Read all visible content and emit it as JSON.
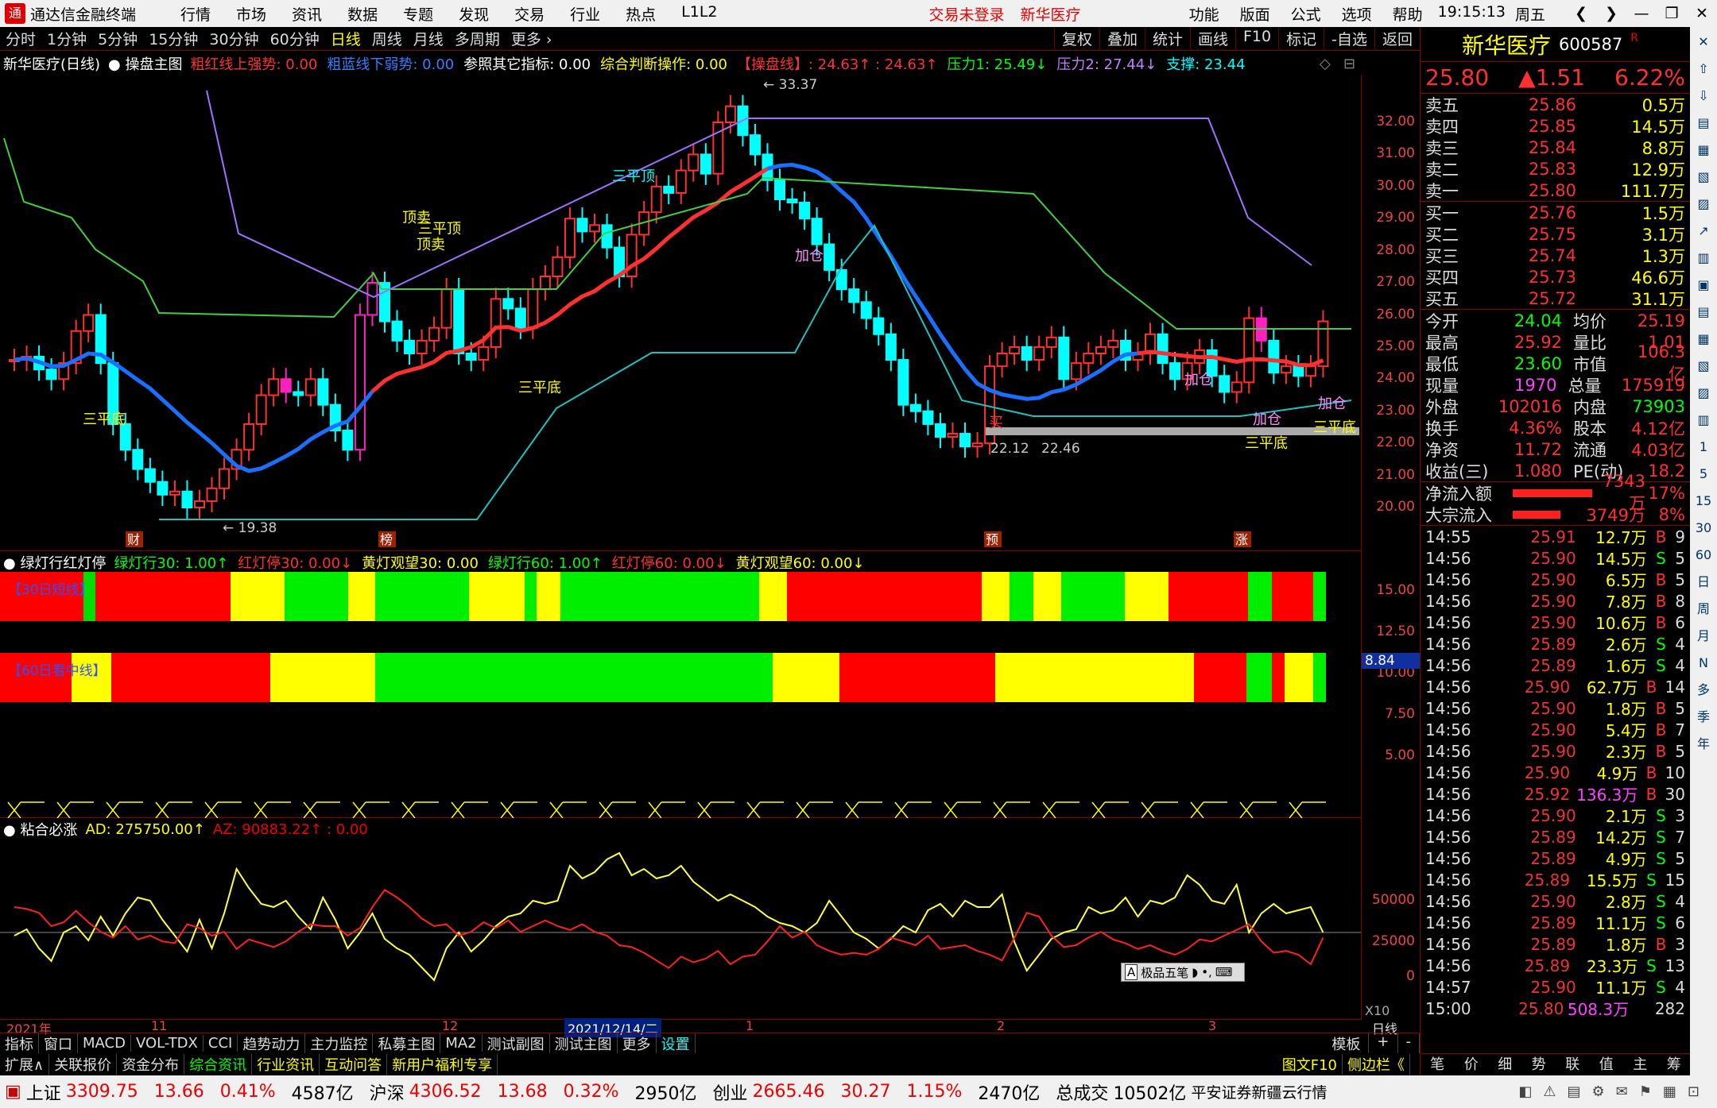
{
  "title_bar": {
    "app_name": "通达信金融终端",
    "menu": [
      "行情",
      "市场",
      "资讯",
      "数据",
      "专题",
      "发现",
      "交易",
      "行业",
      "热点",
      "L1L2"
    ],
    "login_status": "交易未登录",
    "stock_tag": "新华医疗",
    "right_menu": [
      "功能",
      "版面",
      "公式",
      "选项",
      "帮助"
    ],
    "time": "19:15:13",
    "weekday": "周五"
  },
  "toolbar": {
    "periods": [
      "分时",
      "1分钟",
      "5分钟",
      "15分钟",
      "30分钟",
      "60分钟",
      "日线",
      "周线",
      "月线",
      "多周期",
      "更多"
    ],
    "active": "日线",
    "right_buttons": [
      "复权",
      "叠加",
      "统计",
      "画线",
      "F10",
      "标记",
      "-自选",
      "返回"
    ]
  },
  "main_chart": {
    "header": "新华医疗(日线)",
    "indicator": "操盘主图",
    "items": [
      {
        "label": "粗红线上强势:",
        "value": "0.00",
        "color": "#ff3030"
      },
      {
        "label": "粗蓝线下弱势:",
        "value": "0.00",
        "color": "#3080ff"
      },
      {
        "label": "参照其它指标:",
        "value": "0.00",
        "color": "#ffffff"
      },
      {
        "label": "综合判断操作:",
        "value": "0.00",
        "color": "#ffff00"
      },
      {
        "label": "【操盘线】:",
        "value": "24.63↑ : 24.63↑",
        "color": "#ff3030"
      },
      {
        "label": "压力1:",
        "value": "25.49↓",
        "color": "#00ff00"
      },
      {
        "label": "压力2:",
        "value": "27.44↓",
        "color": "#c080ff"
      },
      {
        "label": "支撑:",
        "value": "23.44",
        "color": "#00ffff"
      }
    ],
    "yticks": [
      "32.00",
      "31.00",
      "30.00",
      "29.00",
      "28.00",
      "27.00",
      "26.00",
      "25.00",
      "24.00",
      "23.00",
      "22.00",
      "21.00",
      "20.00"
    ],
    "annotations": {
      "high": "33.37",
      "low": "19.38",
      "low2a": "22.12",
      "low2b": "22.46",
      "signals": [
        "三平底",
        "三平底",
        "三平底",
        "三平底",
        "顶卖",
        "三平顶",
        "顶卖",
        "三平顶",
        "加仓",
        "加仓",
        "加仓",
        "加仓",
        "买"
      ]
    },
    "markers": [
      "财",
      "榜",
      "预",
      "涨"
    ]
  },
  "light_panel": {
    "header": "绿灯行红灯停",
    "items": [
      {
        "label": "绿灯行30:",
        "value": "1.00↑",
        "color": "#00ff00"
      },
      {
        "label": "红灯停30:",
        "value": "0.00↓",
        "color": "#ff3030"
      },
      {
        "label": "黄灯观望30:",
        "value": "0.00",
        "color": "#ffff00"
      },
      {
        "label": "绿灯行60:",
        "value": "1.00↑",
        "color": "#00ff00"
      },
      {
        "label": "红灯停60:",
        "value": "0.00↓",
        "color": "#ff3030"
      },
      {
        "label": "黄灯观望60:",
        "value": "0.00↓",
        "color": "#ffff00"
      }
    ],
    "band1_label": "【30日短线】",
    "band2_label": "【60日看中线】",
    "yticks": [
      "15.00",
      "12.50",
      "10.00",
      "7.50",
      "5.00"
    ],
    "current": "8.84"
  },
  "ad_panel": {
    "header": "粘合必涨",
    "ad": "AD: 275750.00↑",
    "az": "AZ: 90883.22↑ : 0.00",
    "yticks": [
      "50000",
      "25000",
      "0"
    ],
    "x_label": "X10",
    "ime": "极品五笔"
  },
  "x_axis": {
    "labels": [
      "2021年",
      "11",
      "12",
      "2021/12/14/二",
      "1",
      "2",
      "3"
    ],
    "period": "日线"
  },
  "bottom_tabs": [
    "指标",
    "窗口",
    "MACD",
    "VOL-TDX",
    "CCI",
    "趋势动力",
    "主力监控",
    "私募主图",
    "MA2",
    "测试副图",
    "测试主图",
    "更多",
    "设置"
  ],
  "bottom_right": [
    "模板",
    "+",
    "-"
  ],
  "bottom_tabs2": [
    "扩展∧",
    "关联报价",
    "资金分布",
    "综合资讯",
    "行业资讯",
    "互动问答",
    "新用户福利专享"
  ],
  "bottom_right2": [
    "图文F10",
    "侧边栏《"
  ],
  "quote_tabs": [
    "笔",
    "价",
    "细",
    "势",
    "联",
    "值",
    "主",
    "筹"
  ],
  "stock": {
    "name": "新华医疗",
    "code": "600587",
    "flag": "R",
    "price": "25.80",
    "change": "▲1.51",
    "pct": "6.22%"
  },
  "asks": [
    {
      "l": "卖五",
      "p": "25.86",
      "v": "0.5万"
    },
    {
      "l": "卖四",
      "p": "25.85",
      "v": "14.5万"
    },
    {
      "l": "卖三",
      "p": "25.84",
      "v": "8.8万"
    },
    {
      "l": "卖二",
      "p": "25.83",
      "v": "12.9万"
    },
    {
      "l": "卖一",
      "p": "25.80",
      "v": "111.7万"
    }
  ],
  "bids": [
    {
      "l": "买一",
      "p": "25.76",
      "v": "1.5万"
    },
    {
      "l": "买二",
      "p": "25.75",
      "v": "3.1万"
    },
    {
      "l": "买三",
      "p": "25.74",
      "v": "1.3万"
    },
    {
      "l": "买四",
      "p": "25.73",
      "v": "46.6万"
    },
    {
      "l": "买五",
      "p": "25.72",
      "v": "31.1万"
    }
  ],
  "stats": [
    [
      "今开",
      "24.04",
      "均价",
      "25.19"
    ],
    [
      "最高",
      "25.92",
      "量比",
      "1.01"
    ],
    [
      "最低",
      "23.60",
      "市值",
      "106.3亿"
    ],
    [
      "现量",
      "1970",
      "总量",
      "175919"
    ],
    [
      "外盘",
      "102016",
      "内盘",
      "73903"
    ],
    [
      "换手",
      "4.36%",
      "股本",
      "4.12亿"
    ],
    [
      "净资",
      "11.72",
      "流通",
      "4.03亿"
    ],
    [
      "收益(三)",
      "1.080",
      "PE(动)",
      "18.2"
    ]
  ],
  "flows": [
    {
      "l": "净流入额",
      "v": "7343万",
      "p": "17%"
    },
    {
      "l": "大宗流入",
      "v": "3749万",
      "p": "8%"
    }
  ],
  "ticks": [
    [
      "14:55",
      "25.91",
      "12.7万",
      "B",
      "9"
    ],
    [
      "14:56",
      "25.90",
      "14.5万",
      "S",
      "5"
    ],
    [
      "14:56",
      "25.90",
      "6.5万",
      "B",
      "5"
    ],
    [
      "14:56",
      "25.90",
      "7.8万",
      "B",
      "8"
    ],
    [
      "14:56",
      "25.90",
      "10.6万",
      "B",
      "6"
    ],
    [
      "14:56",
      "25.89",
      "2.6万",
      "S",
      "4"
    ],
    [
      "14:56",
      "25.89",
      "1.6万",
      "S",
      "4"
    ],
    [
      "14:56",
      "25.90",
      "62.7万",
      "B",
      "14"
    ],
    [
      "14:56",
      "25.90",
      "1.8万",
      "B",
      "5"
    ],
    [
      "14:56",
      "25.90",
      "5.4万",
      "B",
      "7"
    ],
    [
      "14:56",
      "25.90",
      "2.3万",
      "B",
      "5"
    ],
    [
      "14:56",
      "25.90",
      "4.9万",
      "B",
      "10"
    ],
    [
      "14:56",
      "25.92",
      "136.3万",
      "B",
      "30"
    ],
    [
      "14:56",
      "25.90",
      "2.1万",
      "S",
      "3"
    ],
    [
      "14:56",
      "25.89",
      "14.2万",
      "S",
      "7"
    ],
    [
      "14:56",
      "25.89",
      "4.9万",
      "S",
      "5"
    ],
    [
      "14:56",
      "25.89",
      "15.5万",
      "S",
      "15"
    ],
    [
      "14:56",
      "25.90",
      "2.8万",
      "S",
      "4"
    ],
    [
      "14:56",
      "25.89",
      "11.1万",
      "S",
      "6"
    ],
    [
      "14:56",
      "25.89",
      "1.8万",
      "B",
      "3"
    ],
    [
      "14:56",
      "25.89",
      "23.3万",
      "S",
      "13"
    ],
    [
      "14:57",
      "25.90",
      "11.1万",
      "S",
      "4"
    ],
    [
      "15:00",
      "25.80",
      "508.3万",
      "",
      "282"
    ]
  ],
  "sidebar_labels": [
    "1",
    "5",
    "15",
    "30",
    "60",
    "日",
    "周",
    "月",
    "N",
    "多",
    "季",
    "年"
  ],
  "status": {
    "idx1": "上证",
    "v1": "3309.75",
    "c1": "13.66",
    "p1": "0.41%",
    "a1": "4587亿",
    "idx2": "沪深",
    "v2": "4306.52",
    "c2": "13.68",
    "p2": "0.32%",
    "a2": "2950亿",
    "idx3": "创业",
    "v3": "2665.46",
    "c3": "30.27",
    "p3": "1.15%",
    "a3": "2470亿",
    "total_label": "总成交",
    "total": "10502亿",
    "broker": "平安证券新疆云行情"
  },
  "colors": {
    "up": "#ff3030",
    "down": "#00ffff",
    "green": "#00ff00",
    "yellow": "#ffff00",
    "blue": "#1a6fff",
    "magenta": "#ff20c0"
  }
}
